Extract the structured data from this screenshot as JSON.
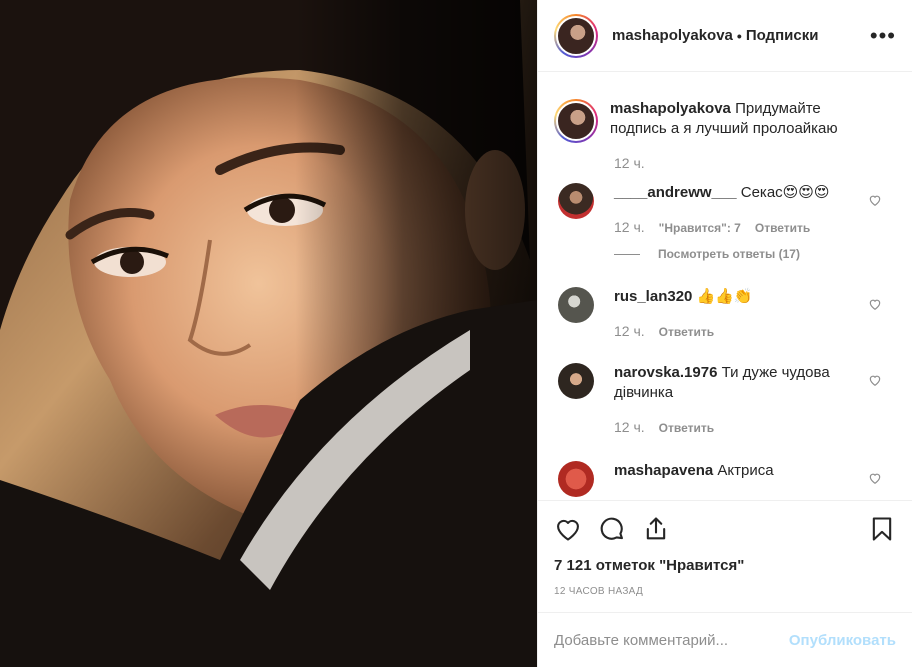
{
  "post": {
    "username": "mashapolyakova",
    "separator": "•",
    "follow_status": "Подписки",
    "more_icon": "more-horizontal-icon"
  },
  "caption": {
    "username": "mashapolyakova",
    "text": "Придумайте подпись а я лучший пролоайкаю",
    "time": "12 ч."
  },
  "comments": [
    {
      "username": "____andreww___",
      "text": "Секас😍😍😍",
      "time": "12 ч.",
      "likes": "\"Нравится\": 7",
      "reply": "Ответить",
      "view_replies": "Посмотреть ответы (17)",
      "avatar_color": "#6a4a3a"
    },
    {
      "username": "rus_lan320",
      "text": "👍👍👏",
      "time": "12 ч.",
      "reply": "Ответить",
      "avatar_color": "#7a7a72"
    },
    {
      "username": "narovska.1976",
      "text": "Ти дуже чудова дівчинка",
      "time": "12 ч.",
      "reply": "Ответить",
      "avatar_color": "#5b4a3a"
    },
    {
      "username": "mashapavena",
      "text": "Актриса",
      "avatar_color": "#c0322e"
    }
  ],
  "actions": {
    "like_icon": "heart-icon",
    "comment_icon": "comment-icon",
    "share_icon": "share-icon",
    "save_icon": "bookmark-icon",
    "likes_count": "7 121 отметок \"Нравится\"",
    "time_ago": "12 ЧАСОВ НАЗАД"
  },
  "add_comment": {
    "placeholder": "Добавьте комментарий...",
    "publish_label": "Опубликовать"
  },
  "colors": {
    "text": "#262626",
    "secondary": "#8e8e8e",
    "border": "#efefef",
    "publish_disabled": "#b2dffc"
  }
}
